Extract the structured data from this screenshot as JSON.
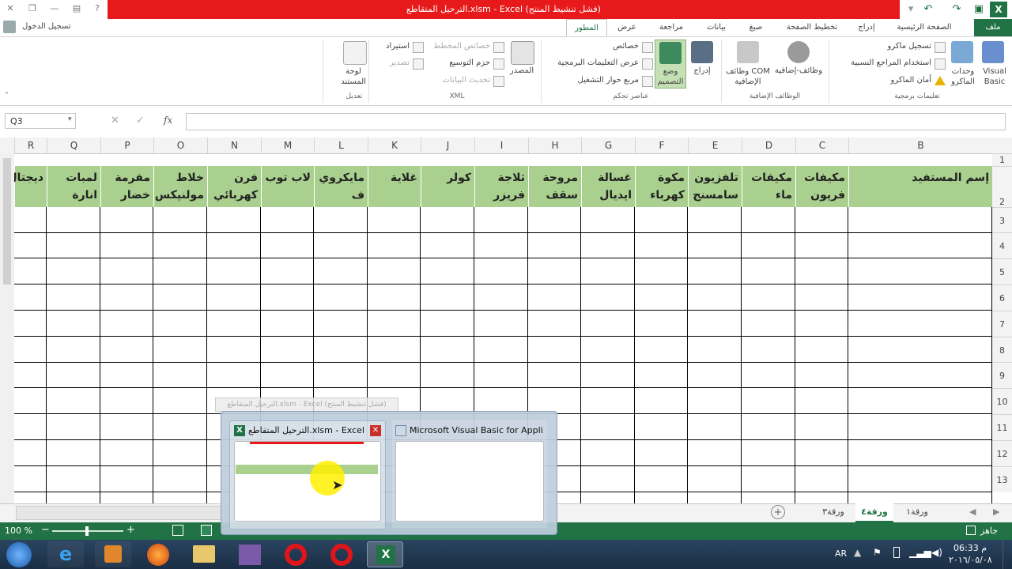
{
  "titlebar": {
    "title": "الترحيل المتقاطع.xlsm - Excel  (فشل تنشيط المنتج)",
    "help": "?"
  },
  "signin": "تسجيل الدخول",
  "tabs": [
    "ملف",
    "الصفحة الرئيسية",
    "إدراج",
    "تخطيط الصفحة",
    "صيغ",
    "بيانات",
    "مراجعة",
    "عرض",
    "المطور"
  ],
  "ribbon": {
    "code": {
      "visual_basic": "Visual Basic",
      "macros": "وحدات الماكرو",
      "record_macro": "تسجيل ماكرو",
      "relative_refs": "استخدام المراجع النسبية",
      "macro_security": "أمان الماكرو",
      "group": "تعليمات برمجية"
    },
    "addins": {
      "addins": "وظائف-إضافية",
      "com_addins": "وظائف COM الإضافية",
      "group": "الوظائف الإضافية"
    },
    "controls": {
      "insert": "إدراج",
      "design_mode": "وضع التصميم",
      "properties": "خصائص",
      "view_code": "عرض التعليمات البرمجية",
      "run_dialog": "مربع حوار التشغيل",
      "group": "عناصر تحكم"
    },
    "xml": {
      "source": "المصدر",
      "map_properties": "خصائص المخطط",
      "expansion_packs": "حزم التوسيع",
      "refresh_data": "تحديث البيانات",
      "import": "استيراد",
      "export": "تصدير",
      "group": "XML"
    },
    "modify": {
      "doc_panel": "لوحة المستند",
      "group": "تعديل"
    }
  },
  "formula_bar": {
    "name_box": "Q3",
    "fx": "fx",
    "value": ""
  },
  "columns": [
    "B",
    "C",
    "D",
    "E",
    "F",
    "G",
    "H",
    "I",
    "J",
    "K",
    "L",
    "M",
    "N",
    "O",
    "P",
    "Q",
    "R"
  ],
  "headers": [
    "إسم المستفيد",
    "مكيفات فريون",
    "مكيفات ماء",
    "تلفزيون سامسنج",
    "مكوة كهرباء",
    "غسالة ايديال",
    "مروحة سقف",
    "ثلاجة فريزر",
    "كولر",
    "غلاية",
    "مايكروي ف",
    "لاب توب",
    "فرن كهربائي",
    "خلاط مولنيكس",
    "مفرمة خضار",
    "لمبات انارة",
    "ديجتال"
  ],
  "rows": [
    "1",
    "2",
    "3",
    "4",
    "5",
    "6",
    "7",
    "8",
    "9",
    "10",
    "11",
    "12",
    "13"
  ],
  "sheet_tabs": [
    "ورقة١",
    "ورقة٤",
    "ورقة٣"
  ],
  "active_sheet": "ورقة٤",
  "status": {
    "ready": "جاهز",
    "zoom": "100 %"
  },
  "taskbar": {
    "lang": "AR",
    "time": "06:33 م",
    "date": "٢٠١٦/٠٥/٠٨"
  },
  "popup": {
    "excel_title": "الترحيل المتقاطع.xlsm - Excel (...",
    "vba_title": "Microsoft Visual Basic for Appli...",
    "ghost_title": "الترحيل المتقاطع.xlsm - Excel  (فشل تنشيط المنتج)"
  },
  "colors": {
    "accent": "#217346",
    "header_fill": "#a9d08e",
    "title_red": "#e8191b"
  }
}
